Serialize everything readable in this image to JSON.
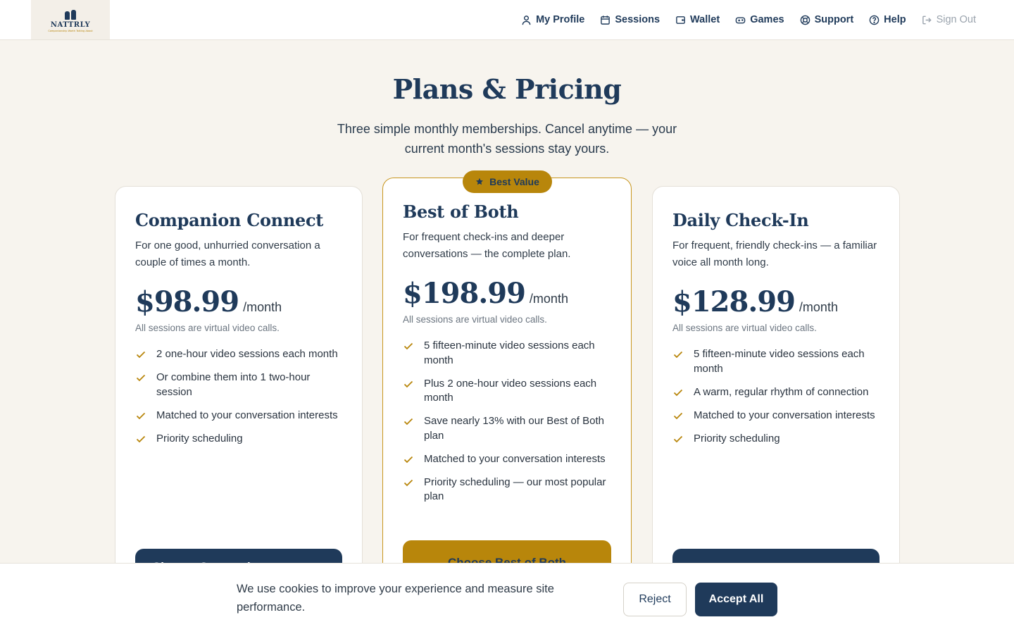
{
  "brand": {
    "name": "NATTRLY",
    "tagline": "Companionship Worth Talking About"
  },
  "nav": {
    "items": [
      {
        "label": "My Profile",
        "icon": "user-icon"
      },
      {
        "label": "Sessions",
        "icon": "calendar-icon"
      },
      {
        "label": "Wallet",
        "icon": "wallet-icon"
      },
      {
        "label": "Games",
        "icon": "gamepad-icon"
      },
      {
        "label": "Support",
        "icon": "lifebuoy-icon"
      },
      {
        "label": "Help",
        "icon": "help-circle-icon"
      },
      {
        "label": "Sign Out",
        "icon": "sign-out-icon"
      }
    ]
  },
  "hero": {
    "title": "Plans & Pricing",
    "subtitle": "Three simple monthly memberships. Cancel anytime — your current month's sessions stay yours."
  },
  "plans": [
    {
      "name": "Companion Connect",
      "description": "For one good, unhurried conversation a couple of times a month.",
      "price": "$98.99",
      "period": "/month",
      "note": "All sessions are virtual video calls.",
      "features": [
        "2 one-hour video sessions each month",
        "Or combine them into 1 two-hour session",
        "Matched to your conversation interests",
        "Priority scheduling"
      ],
      "cta": "Choose Companion"
    },
    {
      "name": "Best of Both",
      "badge": "Best Value",
      "description": "For frequent check-ins and deeper conversations — the complete plan.",
      "price": "$198.99",
      "period": "/month",
      "note": "All sessions are virtual video calls.",
      "features": [
        "5 fifteen-minute video sessions each month",
        "Plus 2 one-hour video sessions each month",
        "Save nearly 13% with our Best of Both plan",
        "Matched to your conversation interests",
        "Priority scheduling — our most popular plan"
      ],
      "cta": "Choose Best of Both"
    },
    {
      "name": "Daily Check-In",
      "description": "For frequent, friendly check-ins — a familiar voice all month long.",
      "price": "$128.99",
      "period": "/month",
      "note": "All sessions are virtual video calls.",
      "features": [
        "5 fifteen-minute video sessions each month",
        "A warm, regular rhythm of connection",
        "Matched to your conversation interests",
        "Priority scheduling"
      ],
      "cta": ""
    }
  ],
  "cookie": {
    "message": "We use cookies to improve your experience and measure site performance.",
    "reject": "Reject",
    "accept": "Accept All"
  },
  "colors": {
    "navy": "#1f3a5a",
    "gold": "#b8860b",
    "background": "#f7f4ee"
  }
}
